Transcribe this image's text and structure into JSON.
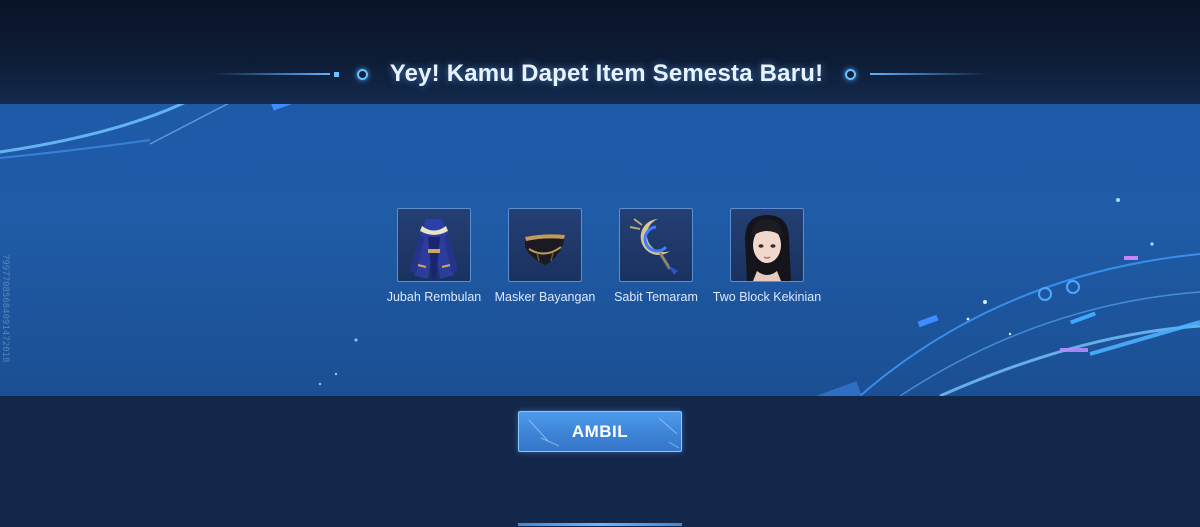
{
  "header": {
    "title": "Yey! Kamu Dapet Item Semesta Baru!"
  },
  "side_code": "79977085684091472018",
  "items": [
    {
      "name": "Jubah Rembulan",
      "icon": "robe-icon"
    },
    {
      "name": "Masker Bayangan",
      "icon": "mask-icon"
    },
    {
      "name": "Sabit Temaram",
      "icon": "crescent-scythe-icon"
    },
    {
      "name": "Two Block Kekinian",
      "icon": "hairstyle-portrait-icon"
    }
  ],
  "actions": {
    "claim_label": "AMBIL"
  },
  "colors": {
    "panel": "#1e5aa8",
    "accent": "#5fb4ff",
    "button": "#4d9bec"
  }
}
